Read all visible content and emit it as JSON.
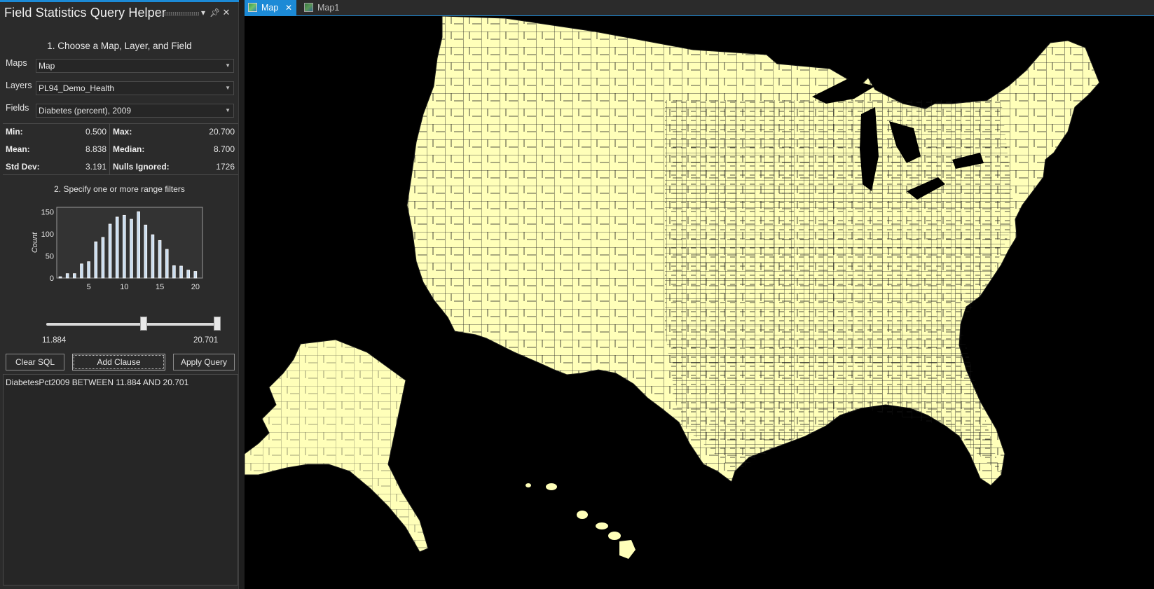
{
  "pane": {
    "title": "Field Statistics Query Helper",
    "pin_icon": "pin-icon",
    "close_icon": "close-icon",
    "menu_icon": "dropdown-arrow-icon"
  },
  "step1": {
    "title": "1. Choose a Map, Layer, and Field"
  },
  "selectors": {
    "maps_label": "Maps",
    "maps_value": "Map",
    "layers_label": "Layers",
    "layers_value": "PL94_Demo_Health",
    "fields_label": "Fields",
    "fields_value": "Diabetes (percent), 2009"
  },
  "stats": {
    "min_label": "Min:",
    "min_value": "0.500",
    "max_label": "Max:",
    "max_value": "20.700",
    "mean_label": "Mean:",
    "mean_value": "8.838",
    "median_label": "Median:",
    "median_value": "8.700",
    "stddev_label": "Std Dev:",
    "stddev_value": "3.191",
    "nulls_label": "Nulls Ignored:",
    "nulls_value": "1726"
  },
  "step2": {
    "title": "2. Specify one or more range filters"
  },
  "chart_data": {
    "type": "bar",
    "ylabel": "Count",
    "xlim": [
      0.5,
      21
    ],
    "ylim": [
      0,
      160
    ],
    "yticks": [
      0,
      50,
      100,
      150
    ],
    "xticks": [
      5,
      10,
      15,
      20
    ],
    "bin_width": 0.5,
    "x": [
      1,
      1.5,
      2,
      2.5,
      3,
      3.5,
      4,
      4.5,
      5,
      5.5,
      6,
      6.5,
      7,
      7.5,
      8,
      8.5,
      9,
      9.5,
      10,
      10.5,
      11,
      11.5,
      12,
      12.5,
      13,
      13.5,
      14,
      14.5,
      15,
      15.5,
      16,
      16.5,
      17,
      17.5,
      18,
      18.5,
      19,
      19.5,
      20,
      20.5
    ],
    "values": [
      3,
      0,
      10,
      0,
      10,
      0,
      32,
      0,
      37,
      0,
      82,
      0,
      92,
      0,
      122,
      0,
      138,
      0,
      142,
      0,
      133,
      0,
      150,
      0,
      120,
      0,
      98,
      0,
      85,
      0,
      65,
      0,
      28,
      0,
      27,
      0,
      18,
      0,
      15,
      0
    ],
    "fill_color": "#c9dcef"
  },
  "slider": {
    "min_value": "11.884",
    "max_value": "20.701",
    "range": [
      0.5,
      20.7
    ],
    "low": 11.884,
    "high": 20.701
  },
  "buttons": {
    "clear": "Clear SQL",
    "add": "Add Clause",
    "apply": "Apply Query"
  },
  "sql": {
    "text": "DiabetesPct2009 BETWEEN 11.884 AND 20.701"
  },
  "tabs": [
    {
      "label": "Map",
      "close": "✕"
    },
    {
      "label": "Map1"
    }
  ],
  "map": {
    "land_color": "#ffffb9",
    "water_color": "#000000"
  }
}
